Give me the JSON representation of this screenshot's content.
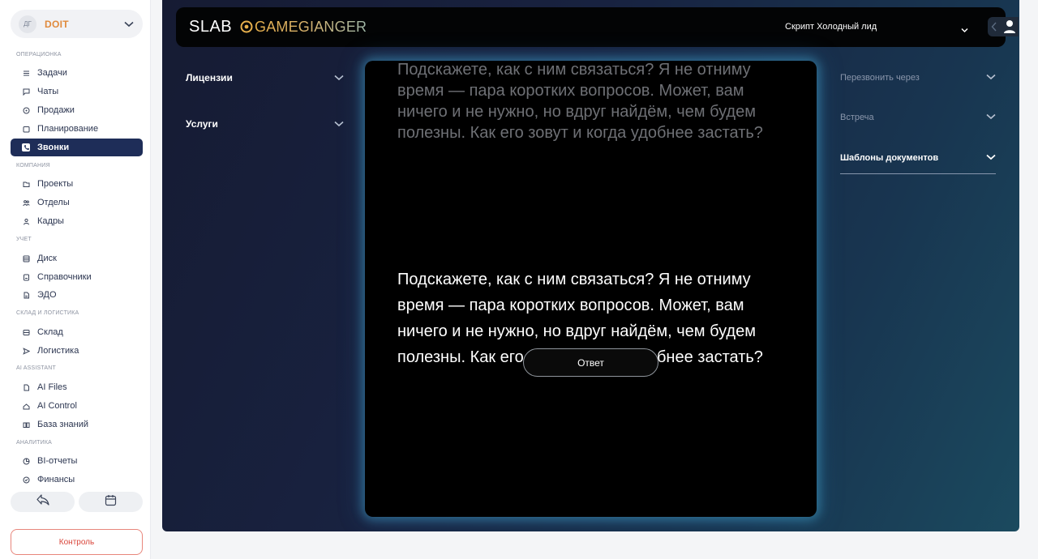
{
  "org": {
    "avatar": "ДГ",
    "name": "DOIT"
  },
  "sidebar": {
    "sections": [
      {
        "title": "ОПЕРАЦИОНКА",
        "items": [
          {
            "label": "Задачи",
            "icon": "list-icon"
          },
          {
            "label": "Чаты",
            "icon": "chat-icon"
          },
          {
            "label": "Продажи",
            "icon": "sales-icon"
          },
          {
            "label": "Планирование",
            "icon": "calendar-icon"
          },
          {
            "label": "Звонки",
            "icon": "phone-icon",
            "active": true
          }
        ]
      },
      {
        "title": "КОМПАНИЯ",
        "items": [
          {
            "label": "Проекты",
            "icon": "folder-icon"
          },
          {
            "label": "Отделы",
            "icon": "team-icon"
          },
          {
            "label": "Кадры",
            "icon": "person-icon"
          }
        ]
      },
      {
        "title": "УЧЕТ",
        "items": [
          {
            "label": "Диск",
            "icon": "database-icon"
          },
          {
            "label": "Справочники",
            "icon": "book-icon"
          },
          {
            "label": "ЭДО",
            "icon": "document-icon"
          }
        ]
      },
      {
        "title": "СКЛАД И ЛОГИСТИКА",
        "items": [
          {
            "label": "Склад",
            "icon": "warehouse-icon"
          },
          {
            "label": "Логистика",
            "icon": "send-icon"
          }
        ]
      },
      {
        "title": "AI ASSISTANT",
        "items": [
          {
            "label": "AI Files",
            "icon": "file-icon"
          },
          {
            "label": "AI Control",
            "icon": "control-icon"
          },
          {
            "label": "База знаний",
            "icon": "knowledge-icon"
          }
        ]
      },
      {
        "title": "АНАЛИТИКА",
        "items": [
          {
            "label": "BI-отчеты",
            "icon": "chart-icon"
          },
          {
            "label": "Финансы",
            "icon": "finance-icon"
          }
        ]
      }
    ],
    "control_label": "Контроль"
  },
  "topbar": {
    "brand_slab": "SLAB",
    "brand_partner": "GAMEGIANGER",
    "script_selected": "Скрипт Холодный лид"
  },
  "left_panel": [
    {
      "label": "Лицензии"
    },
    {
      "label": "Услуги"
    }
  ],
  "right_panel": [
    {
      "label": "Перезвонить через"
    },
    {
      "label": "Встреча"
    },
    {
      "label": "Шаблоны документов"
    }
  ],
  "script_card": {
    "previous_text": "Подскажете, как с ним связаться? Я не отниму время — пара коротких вопросов. Может, вам ничего и не нужно, но вдруг найдём, чем будем полезны. Как его зовут и когда удобнее застать?",
    "current_text": "Подскажете, как с ним связаться? Я не отниму время — пара коротких вопросов. Может, вам ничего и не нужно, но вдруг найдём, чем будем полезны. Как его зовут и когда удобнее застать?",
    "answer_label": "Ответ"
  },
  "colors": {
    "accent_dark": "#1e2d58",
    "brand_orange": "#e08a3c",
    "control_red": "#d9453a"
  }
}
